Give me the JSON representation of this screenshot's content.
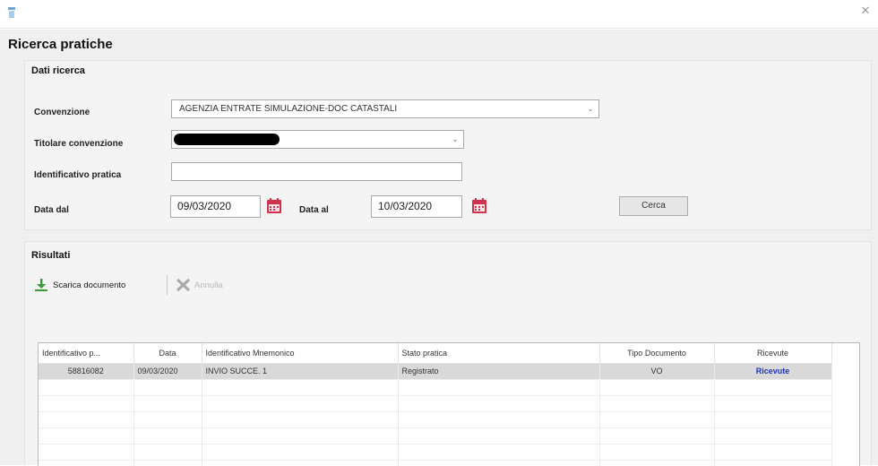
{
  "page": {
    "title": "Ricerca pratiche"
  },
  "search": {
    "section_title": "Dati ricerca",
    "convenzione_label": "Convenzione",
    "convenzione_value": "AGENZIA ENTRATE SIMULAZIONE-DOC CATASTALI",
    "titolare_label": "Titolare convenzione",
    "titolare_value": "",
    "identificativo_label": "Identificativo pratica",
    "identificativo_value": "",
    "data_dal_label": "Data dal",
    "data_dal_value": "09/03/2020",
    "data_al_label": "Data al",
    "data_al_value": "10/03/2020",
    "cerca_label": "Cerca"
  },
  "results": {
    "section_title": "Risultati",
    "toolbar": {
      "download_label": "Scarica documento",
      "cancel_label": "Annulla"
    },
    "columns": [
      "Identificativo p...",
      "Data",
      "Identificativo Mnemonico",
      "Stato pratica",
      "Tipo Documento",
      "Ricevute"
    ],
    "rows": [
      {
        "id": "58816082",
        "data": "09/03/2020",
        "mnemonico": "INVIO SUCCE. 1",
        "stato": "Registrato",
        "tipo": "VO",
        "ricevute": "Ricevute"
      }
    ]
  },
  "colors": {
    "accent_link": "#1a35c4",
    "calendar": "#d2314b",
    "download_arrow": "#3a9b3a"
  },
  "icons": [
    "app-icon",
    "close-icon",
    "chevron-down-icon",
    "calendar-icon",
    "download-icon",
    "cancel-icon"
  ]
}
